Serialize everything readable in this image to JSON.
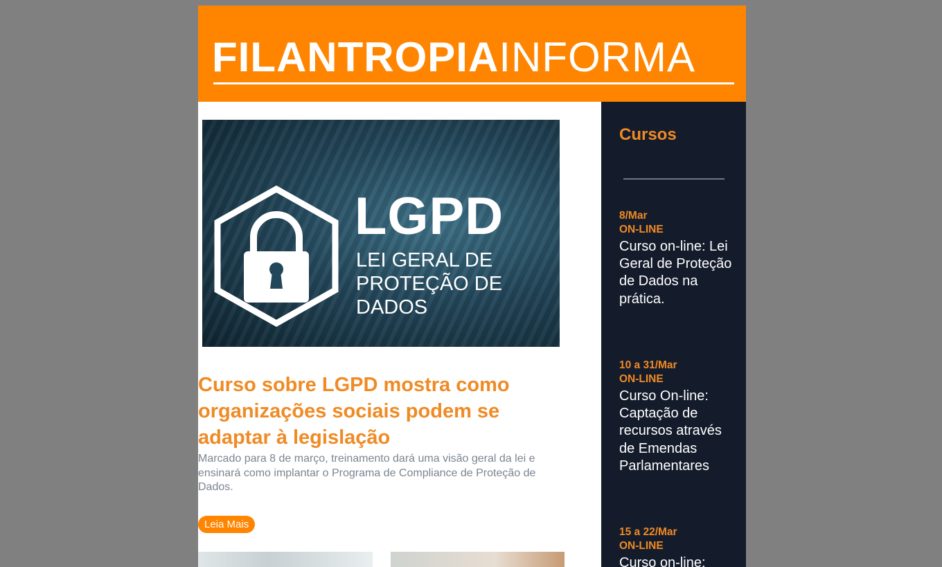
{
  "header": {
    "logo_bold": "FILANTROPIA",
    "logo_light": "INFORMA"
  },
  "hero": {
    "heading": "LGPD",
    "subheading": "LEI GERAL DE PROTEÇÃO DE DADOS"
  },
  "article": {
    "title": "Curso sobre LGPD mostra como organizações sociais podem se adaptar à legislação",
    "summary": "Marcado para 8 de março, treinamento dará uma visão geral da lei e ensinará como implantar o Programa de Compliance de Proteção de Dados.",
    "read_more_label": "Leia Mais"
  },
  "sidebar": {
    "title": "Cursos",
    "courses": [
      {
        "date": "8/Mar",
        "mode": "ON-LINE",
        "name": "Curso on-line: Lei Geral de Proteção de Dados na prática."
      },
      {
        "date": "10 a 31/Mar",
        "mode": "ON-LINE",
        "name": "Curso On-line: Captação de recursos através de Emendas Parlamentares"
      },
      {
        "date": "15 a 22/Mar",
        "mode": "ON-LINE",
        "name": "Curso on-line:"
      }
    ]
  },
  "colors": {
    "brand_orange": "#FF8500",
    "sidebar_bg": "#141C2C",
    "page_bg": "#808080"
  }
}
